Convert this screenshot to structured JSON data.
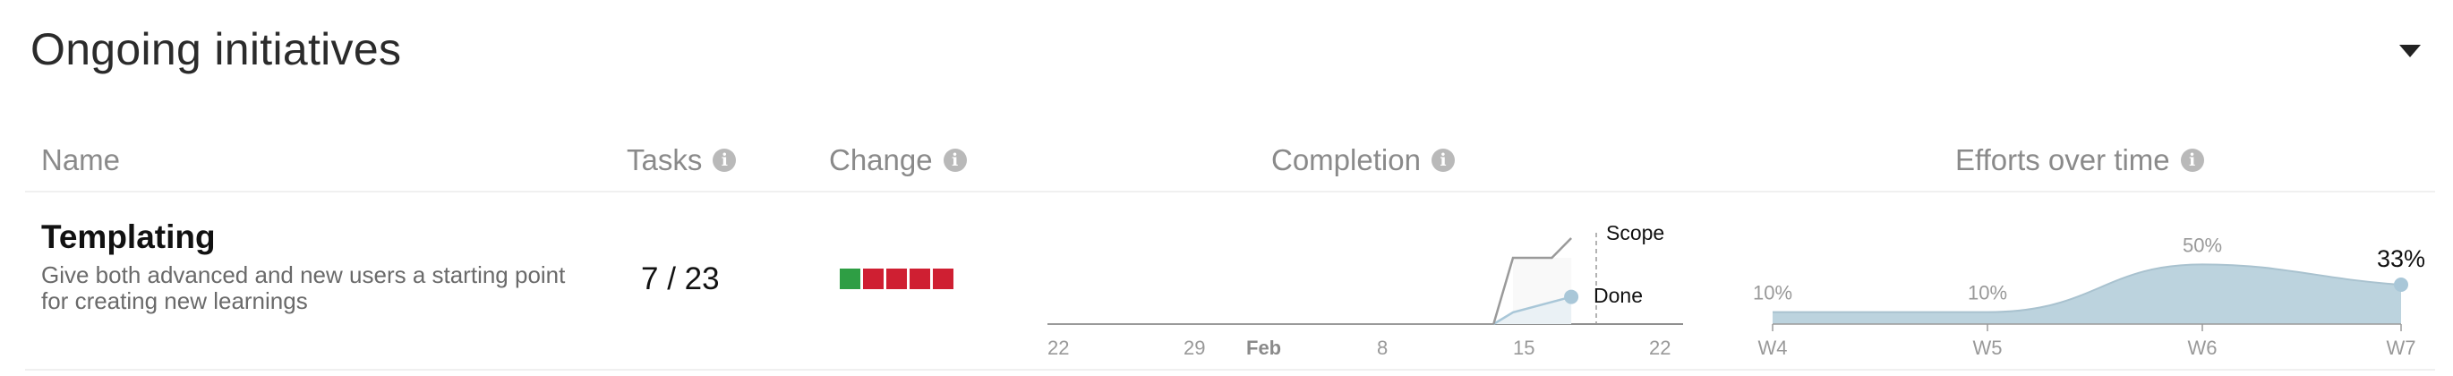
{
  "section": {
    "title": "Ongoing initiatives"
  },
  "columns": {
    "name": "Name",
    "tasks": "Tasks",
    "change": "Change",
    "completion": "Completion",
    "efforts": "Efforts over time"
  },
  "initiative": {
    "name": "Templating",
    "description": "Give both advanced and new users a starting point for creating new learnings",
    "tasks": "7 / 23",
    "change": [
      "positive",
      "negative",
      "negative",
      "negative",
      "negative"
    ]
  },
  "colors": {
    "positive": "#2e9e44",
    "negative": "#cf1f32",
    "scope": "#9a9a9a",
    "done": "#a9c7d8",
    "efforts": "#bcd3de"
  },
  "completion_chart": {
    "x_ticks": [
      "22",
      "29",
      "Feb",
      "8",
      "15",
      "22"
    ],
    "labels": {
      "scope": "Scope",
      "done": "Done"
    },
    "series": {
      "scope": {
        "x": [
          "Feb 14",
          "Feb 15",
          "Feb 16",
          "Feb 17",
          "Feb 18"
        ],
        "y": [
          0,
          23,
          23,
          23,
          23
        ]
      },
      "done": {
        "x": [
          "Feb 14",
          "Feb 15",
          "Feb 18"
        ],
        "y": [
          0,
          3,
          7
        ]
      }
    }
  },
  "efforts_chart": {
    "categories": [
      "W4",
      "W5",
      "W6",
      "W7"
    ],
    "values": [
      10,
      10,
      50,
      33
    ],
    "value_labels": [
      "10%",
      "10%",
      "50%",
      "33%"
    ]
  }
}
